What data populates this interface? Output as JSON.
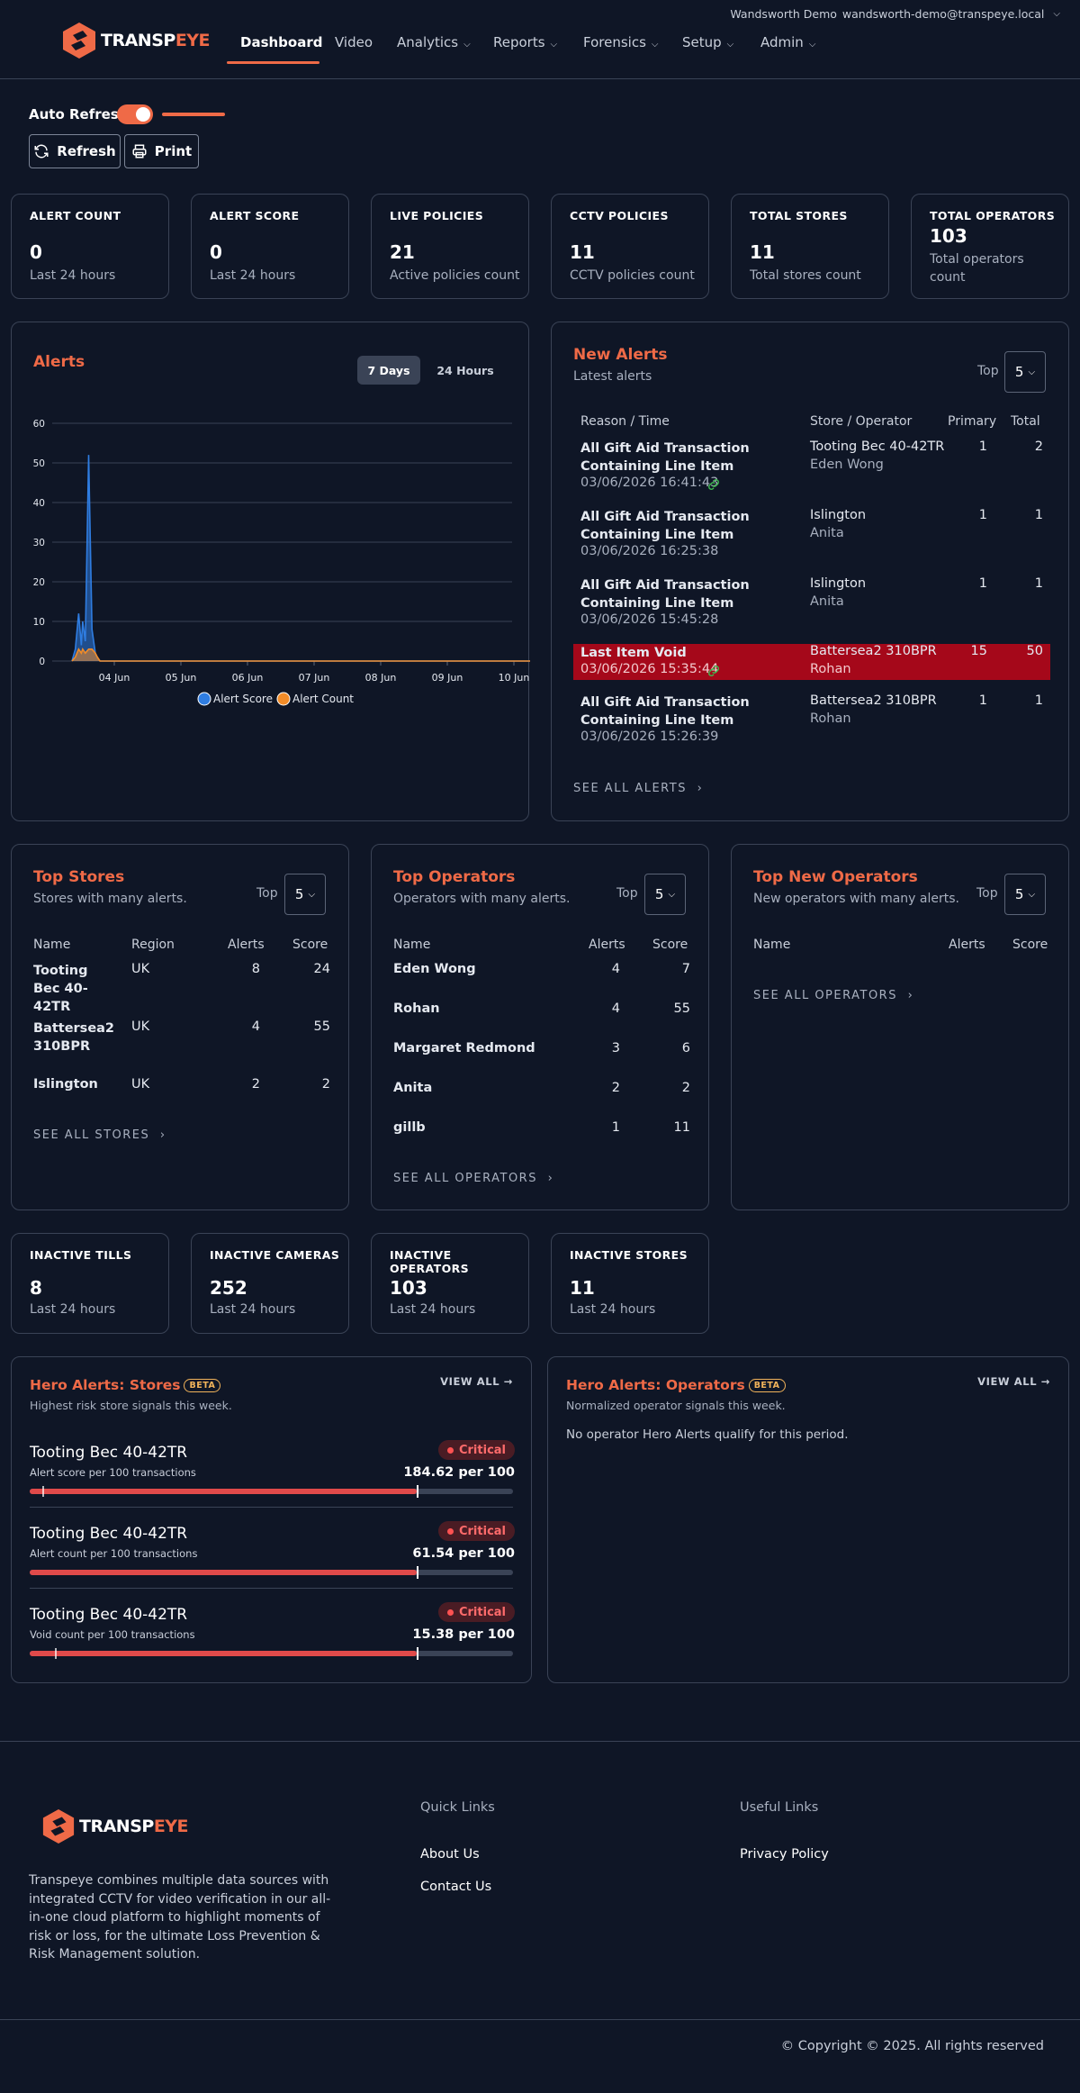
{
  "header": {
    "logo_text_a": "TRANSP",
    "logo_text_b": "EYE",
    "tenant": "Wandsworth Demo",
    "user_email": "wandsworth-demo@transpeye.local",
    "nav": [
      {
        "label": "Dashboard"
      },
      {
        "label": "Video"
      },
      {
        "label": "Analytics"
      },
      {
        "label": "Reports"
      },
      {
        "label": "Forensics"
      },
      {
        "label": "Setup"
      },
      {
        "label": "Admin"
      }
    ]
  },
  "toolbar": {
    "auto_refresh_label": "Auto Refresh",
    "auto_refresh_on": true,
    "refresh_label": "Refresh",
    "print_label": "Print"
  },
  "stats": [
    {
      "title": "ALERT COUNT",
      "value": "0",
      "sub": "Last 24 hours"
    },
    {
      "title": "ALERT SCORE",
      "value": "0",
      "sub": "Last 24 hours"
    },
    {
      "title": "LIVE POLICIES",
      "value": "21",
      "sub": "Active policies count"
    },
    {
      "title": "CCTV POLICIES",
      "value": "11",
      "sub": "CCTV policies count"
    },
    {
      "title": "TOTAL STORES",
      "value": "11",
      "sub": "Total stores count"
    },
    {
      "title": "TOTAL OPERATORS",
      "value": "103",
      "sub": "Total operators count"
    }
  ],
  "alerts_chart": {
    "title": "Alerts",
    "range_7d": "7 Days",
    "range_24h": "24 Hours",
    "selected_range": "7 Days"
  },
  "chart_data": {
    "type": "area",
    "title": "Alerts",
    "x_ticks": [
      "04 Jun",
      "05 Jun",
      "06 Jun",
      "07 Jun",
      "08 Jun",
      "09 Jun",
      "10 Jun"
    ],
    "y_ticks": [
      0,
      10,
      20,
      30,
      40,
      50,
      60
    ],
    "ylim": [
      0,
      60
    ],
    "grid": true,
    "legend": "bottom",
    "x_day_offsets": [
      0,
      0.05,
      0.1,
      0.14,
      0.16,
      0.2,
      0.25,
      0.3,
      0.35,
      0.38,
      0.42,
      0.45,
      0.5,
      1,
      2,
      3,
      4,
      5,
      6,
      7
    ],
    "series": [
      {
        "name": "Alert Score",
        "color": "#2f7de1",
        "values": [
          0,
          3,
          12,
          4,
          10,
          5,
          52,
          8,
          2,
          1,
          0,
          0,
          0,
          0,
          0,
          0,
          0,
          0,
          0,
          0
        ]
      },
      {
        "name": "Alert Count",
        "color": "#f28c28",
        "values": [
          0,
          1,
          3,
          2,
          3,
          2,
          3,
          3,
          2,
          1,
          0,
          0,
          0,
          0,
          0,
          0,
          0,
          0,
          0,
          0
        ]
      }
    ]
  },
  "new_alerts": {
    "title": "New Alerts",
    "subtitle": "Latest alerts",
    "top_label": "Top",
    "top_value": "5",
    "columns": [
      "Reason / Time",
      "Store / Operator",
      "Primary",
      "Total"
    ],
    "rows": [
      {
        "reason": "All Gift Aid Transaction Containing Line Item",
        "time": "03/06/2026 16:41:43",
        "store": "Tooting Bec 40-42TR",
        "operator": "Eden Wong",
        "primary": "1",
        "total": "2",
        "linked": true,
        "highlight": false
      },
      {
        "reason": "All Gift Aid Transaction Containing Line Item",
        "time": "03/06/2026 16:25:38",
        "store": "Islington",
        "operator": "Anita",
        "primary": "1",
        "total": "1",
        "linked": false,
        "highlight": false
      },
      {
        "reason": "All Gift Aid Transaction Containing Line Item",
        "time": "03/06/2026 15:45:28",
        "store": "Islington",
        "operator": "Anita",
        "primary": "1",
        "total": "1",
        "linked": false,
        "highlight": false
      },
      {
        "reason": "Last Item Void",
        "time": "03/06/2026 15:35:44",
        "store": "Battersea2 310BPR",
        "operator": "Rohan",
        "primary": "15",
        "total": "50",
        "linked": true,
        "highlight": true
      },
      {
        "reason": "All Gift Aid Transaction Containing Line Item",
        "time": "03/06/2026 15:26:39",
        "store": "Battersea2 310BPR",
        "operator": "Rohan",
        "primary": "1",
        "total": "1",
        "linked": false,
        "highlight": false
      }
    ],
    "see_all": "SEE ALL ALERTS"
  },
  "top_stores": {
    "title": "Top Stores",
    "subtitle": "Stores with many alerts.",
    "top_label": "Top",
    "top_value": "5",
    "columns": [
      "Name",
      "Region",
      "Alerts",
      "Score"
    ],
    "rows": [
      {
        "name": "Tooting Bec 40-42TR",
        "region": "UK",
        "alerts": "8",
        "score": "24"
      },
      {
        "name": "Battersea2 310BPR",
        "region": "UK",
        "alerts": "4",
        "score": "55"
      },
      {
        "name": "Islington",
        "region": "UK",
        "alerts": "2",
        "score": "2"
      }
    ],
    "see_all": "SEE ALL STORES"
  },
  "top_operators": {
    "title": "Top Operators",
    "subtitle": "Operators with many alerts.",
    "top_label": "Top",
    "top_value": "5",
    "columns": [
      "Name",
      "Alerts",
      "Score"
    ],
    "rows": [
      {
        "name": "Eden Wong",
        "alerts": "4",
        "score": "7"
      },
      {
        "name": "Rohan",
        "alerts": "4",
        "score": "55"
      },
      {
        "name": "Margaret Redmond",
        "alerts": "3",
        "score": "6"
      },
      {
        "name": "Anita",
        "alerts": "2",
        "score": "2"
      },
      {
        "name": "gillb",
        "alerts": "1",
        "score": "11"
      }
    ],
    "see_all": "SEE ALL OPERATORS"
  },
  "top_new_operators": {
    "title": "Top New Operators",
    "subtitle": "New operators with many alerts.",
    "top_label": "Top",
    "top_value": "5",
    "columns": [
      "Name",
      "Alerts",
      "Score"
    ],
    "see_all": "SEE ALL OPERATORS"
  },
  "inactive": [
    {
      "title": "INACTIVE TILLS",
      "value": "8",
      "sub": "Last 24 hours"
    },
    {
      "title": "INACTIVE CAMERAS",
      "value": "252",
      "sub": "Last 24 hours"
    },
    {
      "title": "INACTIVE OPERATORS",
      "value": "103",
      "sub": "Last 24 hours"
    },
    {
      "title": "INACTIVE STORES",
      "value": "11",
      "sub": "Last 24 hours"
    }
  ],
  "hero_stores": {
    "title": "Hero Alerts: Stores",
    "badge": "BETA",
    "subtitle": "Highest risk store signals this week.",
    "view_all": "VIEW ALL →",
    "items": [
      {
        "store": "Tooting Bec 40-42TR",
        "metric": "Alert score per 100 transactions",
        "status": "Critical",
        "value": "184.62 per 100",
        "fill": 0.8
      },
      {
        "store": "Tooting Bec 40-42TR",
        "metric": "Alert count per 100 transactions",
        "status": "Critical",
        "value": "61.54 per 100",
        "fill": 0.8
      },
      {
        "store": "Tooting Bec 40-42TR",
        "metric": "Void count per 100 transactions",
        "status": "Critical",
        "value": "15.38 per 100",
        "fill": 0.8
      }
    ]
  },
  "hero_operators": {
    "title": "Hero Alerts: Operators",
    "badge": "BETA",
    "subtitle": "Normalized operator signals this week.",
    "view_all": "VIEW ALL →",
    "empty": "No operator Hero Alerts qualify for this period."
  },
  "footer": {
    "logo_text_a": "TRANSP",
    "logo_text_b": "EYE",
    "description": "Transpeye combines multiple data sources with integrated CCTV for video verification in our all-in-one cloud platform to highlight moments of risk or loss, for the ultimate Loss Prevention & Risk Management solution.",
    "quick_links_title": "Quick Links",
    "quick_links": [
      "About Us",
      "Contact Us"
    ],
    "useful_links_title": "Useful Links",
    "useful_links": [
      "Privacy Policy"
    ],
    "copyright": "© Copyright © 2025. All rights reserved"
  },
  "colors": {
    "accent": "#ef6a47",
    "background": "#0f1626",
    "critical": "#e04a4a",
    "highlight_row": "#a5081a"
  }
}
